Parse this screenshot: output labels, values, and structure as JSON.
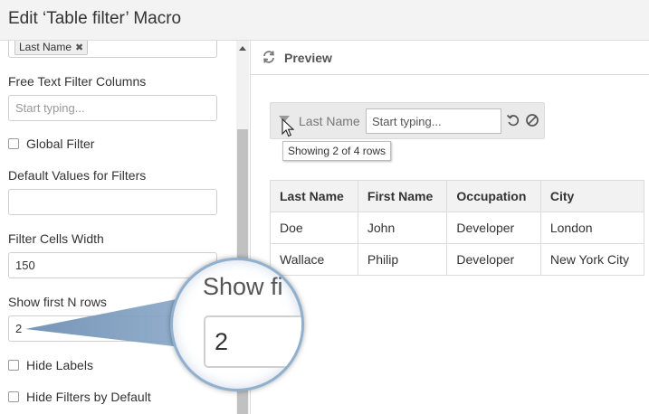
{
  "title": "Edit ‘Table filter’ Macro",
  "left_panel": {
    "tag_value": "Last Name",
    "tag_remove": "✖",
    "free_text_label": "Free Text Filter Columns",
    "free_text_placeholder": "Start typing...",
    "global_filter_label": "Global Filter",
    "default_values_label": "Default Values for Filters",
    "default_values_value": "",
    "cells_width_label": "Filter Cells Width",
    "cells_width_value": "150",
    "show_first_label": "Show first N rows",
    "show_first_value": "2",
    "hide_labels_label": "Hide Labels",
    "hide_filters_label": "Hide Filters by Default"
  },
  "preview": {
    "header_label": "Preview",
    "filter_label": "Last Name",
    "filter_placeholder": "Start typing...",
    "tooltip": "Showing 2 of 4 rows",
    "table": {
      "headers": [
        "Last Name",
        "First Name",
        "Occupation",
        "City"
      ],
      "rows": [
        [
          "Doe",
          "John",
          "Developer",
          "London"
        ],
        [
          "Wallace",
          "Philip",
          "Developer",
          "New York City"
        ]
      ]
    }
  },
  "magnifier": {
    "label": "Show fi",
    "value": "2"
  },
  "colors": {
    "lens_border": "#8fb0cf",
    "scroll_thumb": "#c1c1c1"
  }
}
